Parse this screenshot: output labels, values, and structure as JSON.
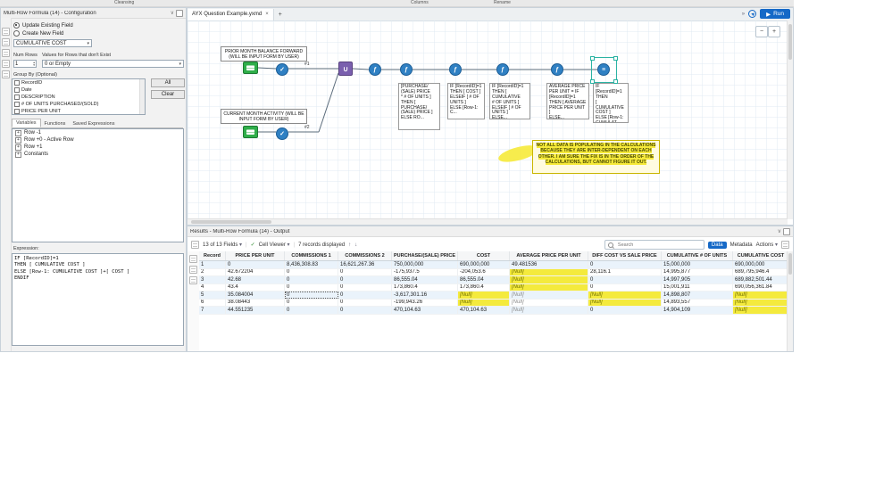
{
  "topbar": {
    "items": [
      "Cleansing",
      "Columns",
      "Rename"
    ]
  },
  "icons": {
    "select": "✓",
    "formula": "ƒ",
    "union": "∪",
    "multirow": "≡"
  },
  "colors": {
    "accent_blue": "#1569c7",
    "highlight_yellow": "#f4ea3d",
    "tool_green": "#2fae4a",
    "tool_blue": "#2f80c3"
  },
  "config": {
    "title": "Multi-Row Formula (14) - Configuration",
    "radio_update": "Update Existing Field",
    "radio_create": "Create New Field",
    "field_value": "CUMULATIVE COST",
    "num_rows_label": "Num Rows",
    "num_rows_value": "1",
    "values_label": "Values for Rows that don't Exist",
    "values_value": "0 or Empty",
    "group_by_label": "Group By (Optional)",
    "group_by_items": [
      "RecordID",
      "Date",
      "DESCRIPTION",
      "# OF UNITS PURCHASED/(SOLD)",
      "PRICE PER UNIT"
    ],
    "all_button": "All",
    "clear_button": "Clear",
    "tabs": [
      "Variables",
      "Functions",
      "Saved Expressions"
    ],
    "tree_items": [
      "Row -1",
      "Row +0 - Active Row",
      "Row +1",
      "Constants"
    ],
    "expression_label": "Expression:",
    "expression": "IF [RecordID]=1\nTHEN [ CUMULATIVE COST ]\nELSE [Row-1: CUMULATIVE COST ]+[ COST ]\nENDIF"
  },
  "canvas": {
    "tab_title": "AYX Question Example.yxmd",
    "tab_close": "×",
    "new_tab": "+",
    "more_tabs": "»",
    "run_icon": "▶",
    "run_label": "Run",
    "zoom_out": "−",
    "zoom_in": "+",
    "annotations": [
      "PRIOR MONTH BALANCE FORWARD (WILL BE INPUT FORM BY USER)",
      "CURRENT MONTH ACTIVITY (WILL BE INPUT FORM BY USER)"
    ],
    "connection_labels": [
      "#1",
      "#2"
    ],
    "captions": [
      "[PURCHASE/\n(SALE) PRICE\n* # OF UNITS ]\nTHEN [\nPURCHASE/\n(SALE) PRICE ]\nELSE RO...",
      "IF [RecordID]=1\nTHEN [ COST ]\nELSEIF [ # OF\nUNITS ]\nELSE [Row-1: C...",
      "IF [RecordID]=1\nTHEN [ CUMULATIVE\n# OF UNITS ]\nELSEIF [ # OF\nUNITS ]\nELSE...",
      "AVERAGE PRICE\nPER UNIT = IF\n[RecordID]=1\nTHEN [ AVERAGE\nPRICE PER UNIT ]\nELSE...",
      "IF [RecordID]=1\nTHEN\n[ CUMULATIVE\nCOST ]\nELSE [Row-1:\nCUMULAT..."
    ],
    "note": "NOT ALL DATA IS POPULATING IN THE CALCULATIONS BECAUSE THEY ARE INTER-DEPENDENT ON EACH OTHER.  I AM SURE THE FIX IS IN THE ORDER OF THE CALCULATIONS, BUT CANNOT FIGURE IT OUT."
  },
  "results": {
    "title": "Results - Multi-Row Formula (14) - Output",
    "fields_dropdown": "13 of 13 Fields",
    "check": "✓",
    "cell_viewer": "Cell Viewer",
    "records_text": "7 records displayed",
    "up_arrow": "↑",
    "down_arrow": "↓",
    "search_placeholder": "Search",
    "data_tab": "Data",
    "metadata_tab": "Metadata",
    "actions_label": "Actions",
    "table": {
      "columns": [
        "Record",
        "PRICE PER UNIT",
        "COMMISSIONS 1",
        "COMMISSIONS 2",
        "PURCHASE/(SALE) PRICE",
        "COST",
        "AVERAGE PRICE PER UNIT",
        "DIFF COST VS SALE PRICE",
        "CUMULATIVE # OF UNITS",
        "CUMULATIVE COST"
      ],
      "rows": [
        [
          "1",
          "0",
          "8,436,308.83",
          "16,621,267.36",
          "750,000,000",
          "690,000,000",
          "49.481536",
          "0",
          "15,000,000",
          "690,000,000"
        ],
        [
          "2",
          "42.672204",
          "0",
          "0",
          "-175,937.5",
          "-204,053.6",
          "[Null]",
          "28,116.1",
          "14,995,877",
          "689,795,946.4"
        ],
        [
          "3",
          "42.68",
          "0",
          "0",
          "86,555.04",
          "86,555.04",
          "[Null]",
          "0",
          "14,997,905",
          "689,882,501.44"
        ],
        [
          "4",
          "43.4",
          "0",
          "0",
          "173,860.4",
          "173,860.4",
          "[Null]",
          "0",
          "15,001,911",
          "690,056,361.84"
        ],
        [
          "5",
          "35.084004",
          "0",
          "0",
          "-3,617,301.16",
          "[Null]",
          "[Null]",
          "[Null]",
          "14,898,807",
          "[Null]"
        ],
        [
          "6",
          "38.08443",
          "0",
          "0",
          "-199,943.26",
          "[Null]",
          "[Null]",
          "[Null]",
          "14,893,557",
          "[Null]"
        ],
        [
          "7",
          "44.551235",
          "0",
          "0",
          "470,104.63",
          "470,104.63",
          "[Null]",
          "0",
          "14,904,109",
          "[Null]"
        ]
      ],
      "highlight_cells": [
        "1,6",
        "2,6",
        "3,6",
        "4,5",
        "4,7",
        "4,9",
        "5,5",
        "5,7",
        "5,9",
        "6,9"
      ],
      "focus_cell": "4,2"
    }
  }
}
